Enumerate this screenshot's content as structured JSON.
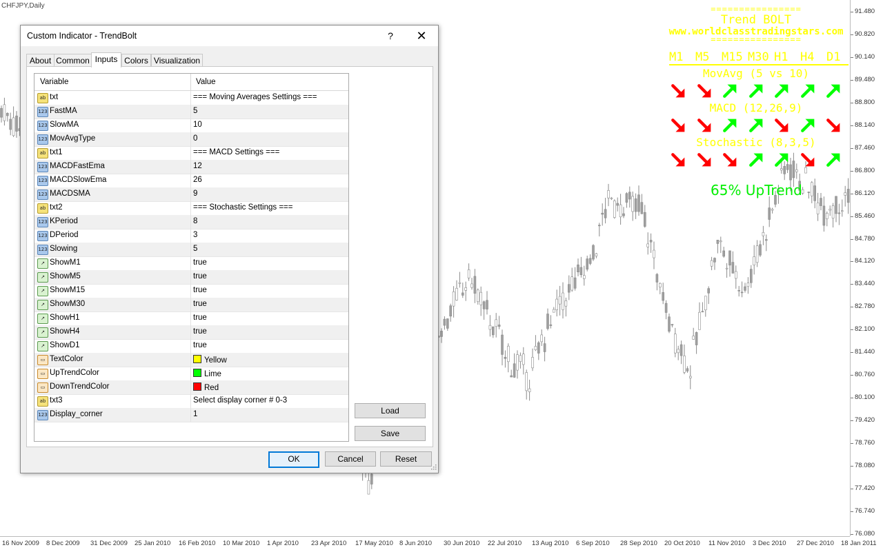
{
  "chart": {
    "symbol": "CHFJPY,Daily",
    "price_ticks": [
      "91.480",
      "90.820",
      "90.140",
      "89.480",
      "88.800",
      "88.140",
      "87.460",
      "86.800",
      "86.120",
      "85.460",
      "84.780",
      "84.120",
      "83.440",
      "82.780",
      "82.100",
      "81.440",
      "80.760",
      "80.100",
      "79.420",
      "78.760",
      "78.080",
      "77.420",
      "76.740",
      "76.080"
    ],
    "time_ticks": [
      "16 Nov 2009",
      "8 Dec 2009",
      "31 Dec 2009",
      "25 Jan 2010",
      "16 Feb 2010",
      "10 Mar 2010",
      "1 Apr 2010",
      "23 Apr 2010",
      "17 May 2010",
      "8 Jun 2010",
      "30 Jun 2010",
      "22 Jul 2010",
      "13 Aug 2010",
      "6 Sep 2010",
      "28 Sep 2010",
      "20 Oct 2010",
      "11 Nov 2010",
      "3 Dec 2010",
      "27 Dec 2010",
      "18 Jan 2011"
    ]
  },
  "overlay": {
    "separator": "================",
    "title": "Trend BOLT",
    "url": "www.worldclasstradingstars.com",
    "timeframes": [
      "M1",
      "M5",
      "M15",
      "M30",
      "H1",
      "H4",
      "D1"
    ],
    "sections": [
      {
        "label": "MovAvg (5 vs 10)",
        "arrows": [
          "down",
          "down",
          "up",
          "up",
          "up",
          "up",
          "up"
        ]
      },
      {
        "label": "MACD (12,26,9)",
        "arrows": [
          "down",
          "down",
          "up",
          "up",
          "down",
          "up",
          "down"
        ]
      },
      {
        "label": "Stochastic (8,3,5)",
        "arrows": [
          "down",
          "down",
          "down",
          "up",
          "up",
          "down",
          "up"
        ]
      }
    ],
    "trend_text": "65% UpTrend",
    "colors": {
      "text": "#ffff00",
      "up": "#00ff00",
      "down": "#ff0000"
    }
  },
  "dialog": {
    "title": "Custom Indicator - TrendBolt",
    "help_label": "?",
    "close_label": "✕",
    "tabs": [
      {
        "label": "About",
        "active": false
      },
      {
        "label": "Common",
        "active": false
      },
      {
        "label": "Inputs",
        "active": true
      },
      {
        "label": "Colors",
        "active": false
      },
      {
        "label": "Visualization",
        "active": false
      }
    ],
    "grid": {
      "col_variable": "Variable",
      "col_value": "Value",
      "rows": [
        {
          "icon": "ab",
          "name": "txt",
          "value": "=== Moving Averages Settings ==="
        },
        {
          "icon": "123",
          "name": "FastMA",
          "value": "5"
        },
        {
          "icon": "123",
          "name": "SlowMA",
          "value": "10"
        },
        {
          "icon": "123",
          "name": "MovAvgType",
          "value": "0"
        },
        {
          "icon": "ab",
          "name": "txt1",
          "value": "=== MACD Settings ==="
        },
        {
          "icon": "123",
          "name": "MACDFastEma",
          "value": "12"
        },
        {
          "icon": "123",
          "name": "MACDSlowEma",
          "value": "26"
        },
        {
          "icon": "123",
          "name": "MACDSMA",
          "value": "9"
        },
        {
          "icon": "ab",
          "name": "txt2",
          "value": "=== Stochastic Settings ==="
        },
        {
          "icon": "123",
          "name": "KPeriod",
          "value": "8"
        },
        {
          "icon": "123",
          "name": "DPeriod",
          "value": "3"
        },
        {
          "icon": "123",
          "name": "Slowing",
          "value": "5"
        },
        {
          "icon": "bool",
          "name": "ShowM1",
          "value": "true"
        },
        {
          "icon": "bool",
          "name": "ShowM5",
          "value": "true"
        },
        {
          "icon": "bool",
          "name": "ShowM15",
          "value": "true"
        },
        {
          "icon": "bool",
          "name": "ShowM30",
          "value": "true"
        },
        {
          "icon": "bool",
          "name": "ShowH1",
          "value": "true"
        },
        {
          "icon": "bool",
          "name": "ShowH4",
          "value": "true"
        },
        {
          "icon": "bool",
          "name": "ShowD1",
          "value": "true"
        },
        {
          "icon": "color",
          "name": "TextColor",
          "value": "Yellow",
          "swatch": "#ffff00"
        },
        {
          "icon": "color",
          "name": "UpTrendColor",
          "value": "Lime",
          "swatch": "#00ff00"
        },
        {
          "icon": "color",
          "name": "DownTrendColor",
          "value": "Red",
          "swatch": "#ff0000"
        },
        {
          "icon": "ab",
          "name": "txt3",
          "value": "Select display corner # 0-3"
        },
        {
          "icon": "123",
          "name": "Display_corner",
          "value": "1"
        }
      ]
    },
    "load_label": "Load",
    "save_label": "Save",
    "ok_label": "OK",
    "cancel_label": "Cancel",
    "reset_label": "Reset"
  }
}
